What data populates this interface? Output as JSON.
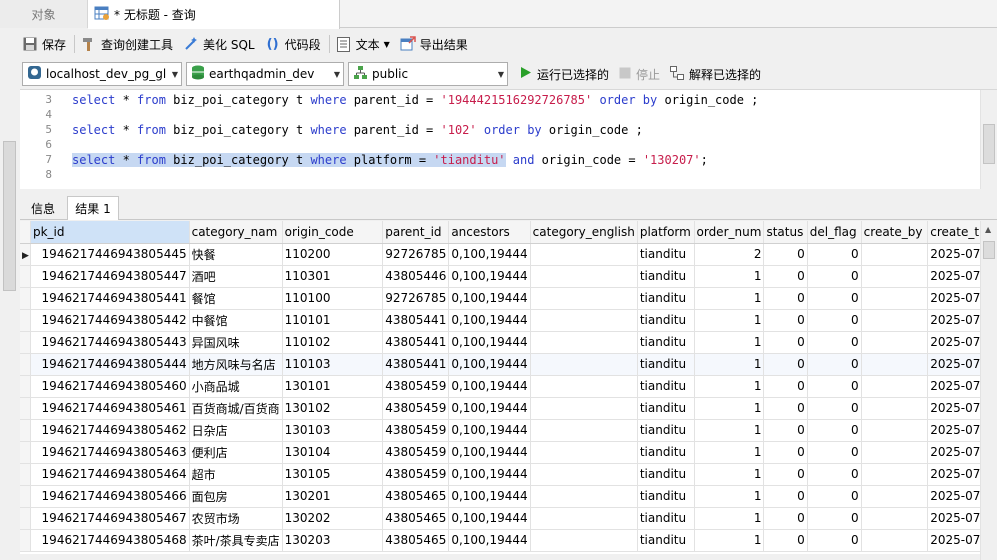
{
  "tabs": {
    "objects_label": "对象",
    "query_label": "* 无标题 - 查询"
  },
  "toolbar": {
    "save": "保存",
    "query_builder": "查询创建工具",
    "beautify_sql": "美化 SQL",
    "code_snippet": "代码段",
    "text": "文本",
    "export_results": "导出结果"
  },
  "connection": {
    "connection_name": "localhost_dev_pg_gl",
    "database_name": "earthqadmin_dev",
    "schema_name": "public",
    "run_selected": "运行已选择的",
    "stop": "停止",
    "explain_selected": "解释已选择的"
  },
  "editor": {
    "lines": [
      {
        "no": "3",
        "parts": [
          [
            "kw",
            "select"
          ],
          [
            "p",
            " * "
          ],
          [
            "kw",
            "from"
          ],
          [
            "p",
            " biz_poi_category t "
          ],
          [
            "kw",
            "where"
          ],
          [
            "p",
            " parent_id = "
          ],
          [
            "str",
            "'1944421516292726785'"
          ],
          [
            "p",
            " "
          ],
          [
            "kw",
            "order by"
          ],
          [
            "p",
            " origin_code ;"
          ]
        ]
      },
      {
        "no": "4",
        "parts": []
      },
      {
        "no": "5",
        "parts": [
          [
            "kw",
            "select"
          ],
          [
            "p",
            " * "
          ],
          [
            "kw",
            "from"
          ],
          [
            "p",
            " biz_poi_category t "
          ],
          [
            "kw",
            "where"
          ],
          [
            "p",
            " parent_id = "
          ],
          [
            "str",
            "'102'"
          ],
          [
            "p",
            " "
          ],
          [
            "kw",
            "order by"
          ],
          [
            "p",
            " origin_code ;"
          ]
        ]
      },
      {
        "no": "6",
        "parts": []
      },
      {
        "no": "7",
        "parts": [
          [
            "kw",
            "select"
          ],
          [
            "p",
            " * "
          ],
          [
            "kw",
            "from"
          ],
          [
            "p",
            " biz_poi_category t "
          ],
          [
            "kw",
            "where"
          ],
          [
            "p",
            " platform = "
          ],
          [
            "str",
            "'tianditu'"
          ],
          [
            "p",
            " "
          ],
          [
            "kw",
            "and"
          ],
          [
            "p",
            " origin_code = "
          ],
          [
            "str",
            "'130207'"
          ],
          [
            "p",
            ";"
          ]
        ],
        "highlight_parts": 7
      },
      {
        "no": "8",
        "parts": []
      }
    ]
  },
  "results_tabs": {
    "info": "信息",
    "result1": "结果 1"
  },
  "grid": {
    "columns": [
      "pk_id",
      "category_nam",
      "origin_code",
      "parent_id",
      "ancestors",
      "category_english",
      "platform",
      "order_num",
      "status",
      "del_flag",
      "create_by",
      "create_tir"
    ],
    "rows": [
      [
        "1946217446943805445",
        "快餐",
        "110200",
        "92726785",
        "0,100,19444",
        "",
        "tianditu",
        "2",
        "0",
        "0",
        "",
        "2025-07-"
      ],
      [
        "1946217446943805447",
        "酒吧",
        "110301",
        "43805446",
        "0,100,19444",
        "",
        "tianditu",
        "1",
        "0",
        "0",
        "",
        "2025-07-"
      ],
      [
        "1946217446943805441",
        "餐馆",
        "110100",
        "92726785",
        "0,100,19444",
        "",
        "tianditu",
        "1",
        "0",
        "0",
        "",
        "2025-07-"
      ],
      [
        "1946217446943805442",
        "中餐馆",
        "110101",
        "43805441",
        "0,100,19444",
        "",
        "tianditu",
        "1",
        "0",
        "0",
        "",
        "2025-07-"
      ],
      [
        "1946217446943805443",
        "异国风味",
        "110102",
        "43805441",
        "0,100,19444",
        "",
        "tianditu",
        "1",
        "0",
        "0",
        "",
        "2025-07-"
      ],
      [
        "1946217446943805444",
        "地方风味与名店",
        "110103",
        "43805441",
        "0,100,19444",
        "",
        "tianditu",
        "1",
        "0",
        "0",
        "",
        "2025-07-"
      ],
      [
        "1946217446943805460",
        "小商品城",
        "130101",
        "43805459",
        "0,100,19444",
        "",
        "tianditu",
        "1",
        "0",
        "0",
        "",
        "2025-07-"
      ],
      [
        "1946217446943805461",
        "百货商城/百货商",
        "130102",
        "43805459",
        "0,100,19444",
        "",
        "tianditu",
        "1",
        "0",
        "0",
        "",
        "2025-07-"
      ],
      [
        "1946217446943805462",
        "日杂店",
        "130103",
        "43805459",
        "0,100,19444",
        "",
        "tianditu",
        "1",
        "0",
        "0",
        "",
        "2025-07-"
      ],
      [
        "1946217446943805463",
        "便利店",
        "130104",
        "43805459",
        "0,100,19444",
        "",
        "tianditu",
        "1",
        "0",
        "0",
        "",
        "2025-07-"
      ],
      [
        "1946217446943805464",
        "超市",
        "130105",
        "43805459",
        "0,100,19444",
        "",
        "tianditu",
        "1",
        "0",
        "0",
        "",
        "2025-07-"
      ],
      [
        "1946217446943805466",
        "面包房",
        "130201",
        "43805465",
        "0,100,19444",
        "",
        "tianditu",
        "1",
        "0",
        "0",
        "",
        "2025-07-"
      ],
      [
        "1946217446943805467",
        "农贸市场",
        "130202",
        "43805465",
        "0,100,19444",
        "",
        "tianditu",
        "1",
        "0",
        "0",
        "",
        "2025-07-"
      ],
      [
        "1946217446943805468",
        "茶叶/茶具专卖店",
        "130203",
        "43805465",
        "0,100,19444",
        "",
        "tianditu",
        "1",
        "0",
        "0",
        "",
        "2025-07-"
      ]
    ]
  },
  "colors": {
    "keyword": "#2b3ccc",
    "string": "#c71d4b",
    "selection": "#c6d8f2",
    "run_green": "#2aa02a"
  }
}
